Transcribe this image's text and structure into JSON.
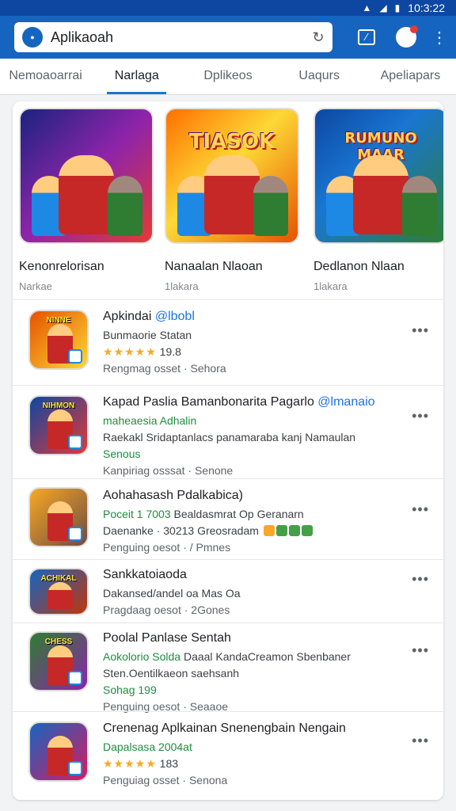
{
  "status_bar": {
    "time": "10:3:22"
  },
  "search": {
    "query": "Aplikaoah"
  },
  "tabs": [
    {
      "label": "Nemoaoarrai",
      "active": false
    },
    {
      "label": "Narlaga",
      "active": true
    },
    {
      "label": "Dplikeos",
      "active": false
    },
    {
      "label": "Uaqurs",
      "active": false
    },
    {
      "label": "Apeliapars",
      "active": false
    }
  ],
  "featured": [
    {
      "title": "Kenonrelorisan",
      "subtitle": "Narkae",
      "banner": "",
      "bg": "linear-gradient(135deg,#1a237e,#8e24aa 50%,#e53935)"
    },
    {
      "title": "Nanaalan Nlaoan",
      "subtitle": "1lakara",
      "banner": "TIASOK",
      "bg": "linear-gradient(135deg,#ff6f00,#fdd835 45%,#e65100)"
    },
    {
      "title": "Dedlanon Nlaan",
      "subtitle": "1lakara",
      "banner": "RUMUNO MAAR",
      "bg": "linear-gradient(135deg,#0d47a1,#1976d2 40%,#2e7d32)"
    }
  ],
  "apps": [
    {
      "icon_tag": "NINNE",
      "icon_bg": "linear-gradient(135deg,#e65100,#fdd835)",
      "title": "Apkindai",
      "title_link": "@lbobl",
      "line2": "Bunmaorie Statan",
      "rating_stars": "★★★★★",
      "rating_value": "19.8",
      "meta": "Rengmag osset · Sehora"
    },
    {
      "icon_tag": "NIHMON",
      "icon_bg": "linear-gradient(135deg,#0d47a1,#e53935)",
      "title": "Kapad Paslia Bamanbonarita Pagarlo",
      "title_link": "@lmanaio",
      "line2": "maheaesia Adhalin",
      "line3": "Raekakl Sridaptanlacs panamaraba kanj Namaulan",
      "line4": "Senous",
      "meta": "Kanpiriag osssat · Senone"
    },
    {
      "icon_tag": "",
      "icon_bg": "linear-gradient(135deg,#f9a825,#6d4c41)",
      "title": "Aohahasash Pdalkabica)",
      "line2_green": "Poceit 1 7003",
      "line2_rest": "Bealdasmrat Op Geranarn",
      "line3": "Daenanke · 30213 Greosradam",
      "meta": "Penguing oesot · / Pmnes"
    },
    {
      "icon_tag": "ACHIKAL",
      "icon_bg": "linear-gradient(135deg,#1565c0,#bf360c)",
      "title": "Sankkatoiaoda",
      "line2": "Dakansed/andel oa Mas Oa",
      "meta": "Pragdaag oesot · 2Gones"
    },
    {
      "icon_tag": "CHESS",
      "icon_bg": "linear-gradient(135deg,#2e7d32,#8e24aa)",
      "title": "Poolal Panlase Sentah",
      "line2_green": "Aokolorio Solda",
      "line2_rest": "Daaal KandaCreamon Sbenbaner",
      "line3": "Sten.Oentilkaeon saehsanh",
      "line4": "Sohag 199",
      "meta": "Penguing oesot · Seaaoe"
    },
    {
      "icon_tag": "",
      "icon_bg": "linear-gradient(135deg,#1565c0,#d81b60)",
      "title": "Crenenag Aplkainan Snenengbain Nengain",
      "line2_green": "Dapalsasa 2004at",
      "rating_stars": "★★★★★",
      "rating_value": "183",
      "meta": "Penguiag osset · Senona"
    }
  ]
}
